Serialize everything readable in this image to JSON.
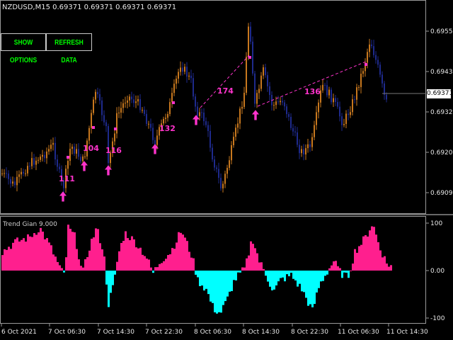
{
  "window": {
    "symbol_info": "NZDUSD,M15  0.69371 0.69371 0.69371 0.69371"
  },
  "buttons": {
    "show_options": "SHOW OPTIONS",
    "refresh_data": "REFRESH DATA"
  },
  "price_axis": {
    "labels": [
      "0.69550",
      "0.69435",
      "0.69320",
      "0.69205",
      "0.69090"
    ],
    "current_price": "0.69371"
  },
  "indicator": {
    "label": "Trend Gian 9.000",
    "axis_labels": [
      "100",
      "0.00",
      "-100"
    ]
  },
  "time_axis": {
    "labels": [
      "6 Oct 2021",
      "7 Oct 06:30",
      "7 Oct 14:30",
      "7 Oct 22:30",
      "8 Oct 06:30",
      "8 Oct 14:30",
      "8 Oct 22:30",
      "11 Oct 06:30",
      "11 Oct 14:30"
    ]
  },
  "signals": {
    "labels": [
      "111",
      "104",
      "116",
      "132",
      "174",
      "136"
    ]
  },
  "colors": {
    "bull_candle": "#c8781e",
    "bear_candle": "#1e2a8c",
    "indicator_positive": "#ff1f8e",
    "indicator_negative": "#00ffff",
    "signal": "#ff33cc",
    "button_text": "#00ff00"
  }
}
